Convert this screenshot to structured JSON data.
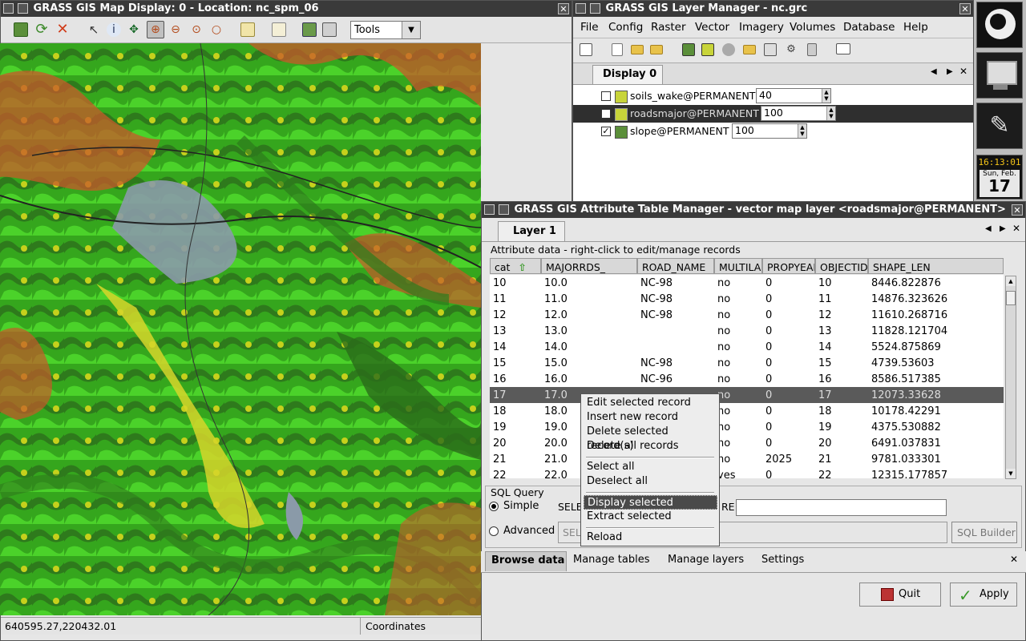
{
  "map_display": {
    "title": "GRASS GIS Map Display: 0 - Location: nc_spm_06",
    "tools_combo": "Tools",
    "status_coords": "640595.27,220432.01",
    "status_mode": "Coordinates"
  },
  "layer_manager": {
    "title": "GRASS GIS Layer Manager - nc.grc",
    "menu": [
      "File",
      "Config",
      "Raster",
      "Vector",
      "Imagery",
      "Volumes",
      "Database",
      "Help"
    ],
    "display_tab": "Display 0",
    "layers": [
      {
        "name": "soils_wake@PERMANENT",
        "opacity": "40",
        "checked": false
      },
      {
        "name": "roadsmajor@PERMANENT",
        "opacity": "100",
        "checked": false
      },
      {
        "name": "slope@PERMANENT",
        "opacity": "100",
        "checked": true
      }
    ]
  },
  "dock": {
    "clock_time": "16:13:01",
    "clock_day": "Sun, Feb.",
    "clock_date": "17"
  },
  "attribute_manager": {
    "title": "GRASS GIS Attribute Table Manager - vector map layer <roadsmajor@PERMANENT>",
    "layer_tab": "Layer 1",
    "group_label": "Attribute data - right-click to edit/manage records",
    "columns": [
      "cat",
      "MAJORRDS_",
      "ROAD_NAME",
      "MULTILAN",
      "PROPYEAR",
      "OBJECTID",
      "SHAPE_LEN"
    ],
    "rows": [
      [
        "10",
        "10.0",
        "NC-98",
        "no",
        "0",
        "10",
        "8446.822876"
      ],
      [
        "11",
        "11.0",
        "NC-98",
        "no",
        "0",
        "11",
        "14876.323626"
      ],
      [
        "12",
        "12.0",
        "NC-98",
        "no",
        "0",
        "12",
        "11610.268716"
      ],
      [
        "13",
        "13.0",
        "",
        "no",
        "0",
        "13",
        "11828.121704"
      ],
      [
        "14",
        "14.0",
        "",
        "no",
        "0",
        "14",
        "5524.875869"
      ],
      [
        "15",
        "15.0",
        "NC-98",
        "no",
        "0",
        "15",
        "4739.53603"
      ],
      [
        "16",
        "16.0",
        "NC-96",
        "no",
        "0",
        "16",
        "8586.517385"
      ],
      [
        "17",
        "17.0",
        "",
        "no",
        "0",
        "17",
        "12073.33628"
      ],
      [
        "18",
        "18.0",
        "",
        "no",
        "0",
        "18",
        "10178.42291"
      ],
      [
        "19",
        "19.0",
        "",
        "no",
        "0",
        "19",
        "4375.530882"
      ],
      [
        "20",
        "20.0",
        "",
        "no",
        "0",
        "20",
        "6491.037831"
      ],
      [
        "21",
        "21.0",
        "",
        "no",
        "2025",
        "21",
        "9781.033301"
      ],
      [
        "22",
        "22.0",
        "",
        "yes",
        "0",
        "22",
        "12315.177857"
      ]
    ],
    "sql_label": "SQL Query",
    "simple_label": "Simple",
    "advanced_label": "Advanced",
    "select_prefix": "SELE",
    "where_suffix": "RE",
    "advanced_prefix": "SEL",
    "sql_builder": "SQL Builder",
    "bottom_tabs": [
      "Browse data",
      "Manage tables",
      "Manage layers",
      "Settings"
    ],
    "quit_label": "Quit",
    "apply_label": "Apply"
  },
  "context_menu": {
    "items": [
      "Edit selected record",
      "Insert new record",
      "Delete selected record(s)",
      "Delete all records",
      "Select all",
      "Deselect all",
      "Display selected",
      "Extract selected",
      "Reload"
    ]
  }
}
